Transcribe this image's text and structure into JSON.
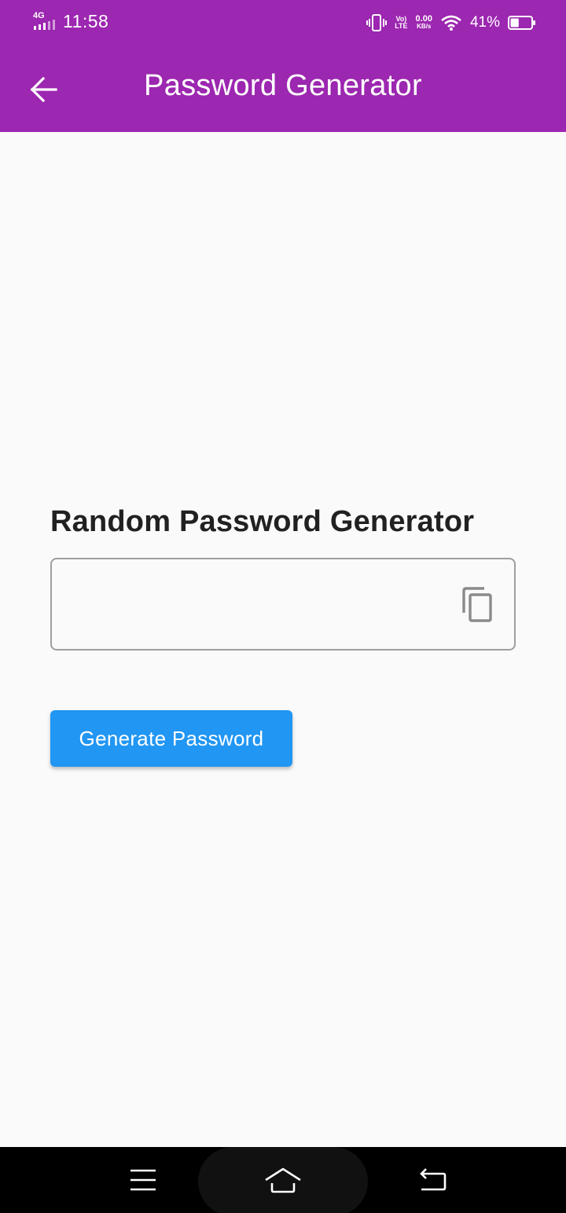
{
  "status_bar": {
    "network": "4G",
    "time": "11:58",
    "volte_top": "Vo)",
    "volte_bottom": "LTE",
    "speed_top": "0.00",
    "speed_bottom": "KB/s",
    "battery_percent": "41%",
    "battery_level": 0.41
  },
  "app_bar": {
    "title": "Password Generator",
    "back_icon": "arrow-left-icon"
  },
  "main": {
    "heading": "Random Password Generator",
    "password_value": "",
    "copy_icon": "copy-icon",
    "generate_label": "Generate Password"
  },
  "colors": {
    "app_bar": "#9c27b0",
    "button": "#2196f3",
    "background": "#fafafa"
  },
  "nav_bar": {
    "icons": [
      "menu-icon",
      "home-icon",
      "back-icon"
    ]
  }
}
